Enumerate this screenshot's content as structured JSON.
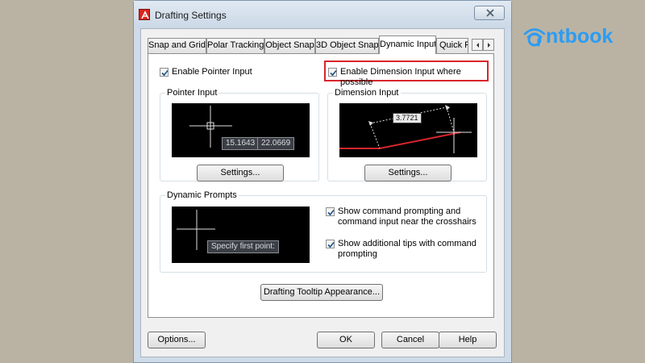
{
  "window": {
    "title": "Drafting Settings",
    "accent_color": "#d7262c"
  },
  "tabs": [
    {
      "label": "Snap and Grid"
    },
    {
      "label": "Polar Tracking"
    },
    {
      "label": "Object Snap"
    },
    {
      "label": "3D Object Snap"
    },
    {
      "label": "Dynamic Input",
      "active": true
    },
    {
      "label": "Quick Pr"
    }
  ],
  "dynamic_input": {
    "enable_pointer_input": {
      "label": "Enable Pointer Input",
      "checked": true
    },
    "enable_dimension_input": {
      "label": "Enable Dimension Input where possible",
      "checked": true
    },
    "pointer_input": {
      "title": "Pointer Input",
      "x_value": "15.1643",
      "y_value": "22.0669",
      "settings_label": "Settings..."
    },
    "dimension_input": {
      "title": "Dimension Input",
      "value": "3.7721",
      "settings_label": "Settings..."
    },
    "dynamic_prompts": {
      "title": "Dynamic Prompts",
      "prompt_text": "Specify first point:",
      "show_command_prompting": {
        "label": "Show command prompting and command input near the crosshairs",
        "checked": true
      },
      "show_additional_tips": {
        "label": "Show additional tips with command prompting",
        "checked": true
      }
    },
    "tooltip_appearance_label": "Drafting Tooltip Appearance..."
  },
  "footer": {
    "options_label": "Options...",
    "ok_label": "OK",
    "cancel_label": "Cancel",
    "help_label": "Help"
  },
  "logo": {
    "text": "ntbook",
    "color": "#2b9cf3"
  }
}
